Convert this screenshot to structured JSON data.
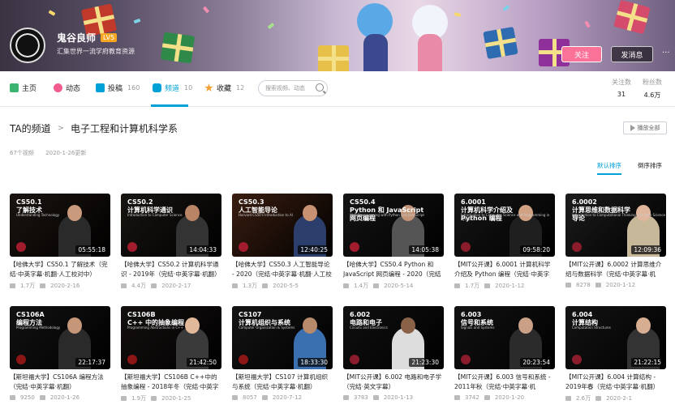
{
  "user": {
    "name": "鬼谷良师",
    "level": "LV5",
    "signature": "汇集世界一流学府教育资源",
    "follow_label": "关注",
    "message_label": "发消息",
    "more": "···"
  },
  "nav": {
    "items": [
      {
        "label": "主页",
        "count": ""
      },
      {
        "label": "动态",
        "count": ""
      },
      {
        "label": "投稿",
        "count": "160"
      },
      {
        "label": "频道",
        "count": "10"
      },
      {
        "label": "收藏",
        "count": "12"
      }
    ],
    "search_placeholder": "搜索视频、动态",
    "stats": [
      {
        "label": "关注数",
        "value": "31"
      },
      {
        "label": "粉丝数",
        "value": "4.6万"
      }
    ]
  },
  "channel": {
    "crumb_root": "TA的频道",
    "crumb_sep": ">",
    "name": "电子工程和计算机科学系",
    "play_all": "播放全部",
    "video_count": "67个视频",
    "updated": "2020-1-26更新",
    "sort_default": "默认排序",
    "sort_reverse": "倒序排序"
  },
  "colors": {
    "accent": "#00a1d6",
    "follow": "#fb7299"
  },
  "videos": [
    {
      "thumb_title": "CS50.1\n了解技术",
      "thumb_sub": "Understanding Technology",
      "duration": "05:55:18",
      "title": "【哈佛大学】CS50.1 了解技术（完结·中英字幕·机翻·人工校对中）",
      "views": "1.7万",
      "date": "2020-2-16",
      "bg": "#1b1410",
      "skin": "#c99a7c",
      "shirt": "#2a2a2a",
      "logo": "#a11c2c"
    },
    {
      "thumb_title": "CS50.2\n计算机科学通识",
      "thumb_sub": "Introduction to Computer Science",
      "duration": "14:04:33",
      "title": "【哈佛大学】CS50.2 计算机科学通识 - 2019年（完结·中英字幕·机翻）",
      "views": "4.4万",
      "date": "2020-2-17",
      "bg": "#181512",
      "skin": "#b98466",
      "shirt": "#333",
      "logo": "#a11c2c"
    },
    {
      "thumb_title": "CS50.3\n人工智能导论",
      "thumb_sub": "Harvard CS50's Introduction to AI",
      "duration": "12:40:25",
      "title": "【哈佛大学】CS50.3 人工智能导论 - 2020（完结·中英字幕·机翻·人工校",
      "views": "1.3万",
      "date": "2020-5-5",
      "bg": "#3a1d10",
      "skin": "#c89272",
      "shirt": "#2c3e6b",
      "logo": "#a11c2c"
    },
    {
      "thumb_title": "CS50.4\nPython 和 JavaScript\n网页编程",
      "thumb_sub": "Web Programming with Python and JavaScript",
      "duration": "14:05:38",
      "title": "【哈佛大学】CS50.4 Python 和 JavaScript 网页编程 - 2020（完结",
      "views": "1.4万",
      "date": "2020-5-14",
      "bg": "#141414",
      "skin": "#c29477",
      "shirt": "#555",
      "logo": "#a11c2c"
    },
    {
      "thumb_title": "6.0001\n计算机科学介绍及\nPython 编程",
      "thumb_sub": "Introduction to Computer Science and Programming in Python",
      "duration": "09:58:20",
      "title": "【MIT公开课】6.0001 计算机科学介绍及 Python 编程（完结·中英字",
      "views": "1.7万",
      "date": "2020-1-12",
      "bg": "#161616",
      "skin": "#d1a184",
      "shirt": "#1f1f1f",
      "logo": "#8a1c2c"
    },
    {
      "thumb_title": "6.0002\n计算思维和数据科学\n导论",
      "thumb_sub": "Introduction to Computational Thinking and Data Science",
      "duration": "12:09:36",
      "title": "【MIT公开课】6.0002 计算思维介绍与数据科学（完结·中英字幕·机",
      "views": "8278",
      "date": "2020-1-12",
      "bg": "#1c1c1c",
      "skin": "#e0b69c",
      "shirt": "#c8b89a",
      "logo": "#8a1c2c"
    },
    {
      "thumb_title": "CS106A\n编程方法",
      "thumb_sub": "Programming Methodology",
      "duration": "22:17:37",
      "title": "【斯坦福大学】CS106A 编程方法（完结·中英字幕·机翻）",
      "views": "9250",
      "date": "2020-1-26",
      "bg": "#121212",
      "skin": "#c69679",
      "shirt": "#2a2a2a",
      "logo": "#8c1515"
    },
    {
      "thumb_title": "CS106B\nC++ 中的抽象编程",
      "thumb_sub": "Programming Abstractions in C++",
      "duration": "21:42:50",
      "title": "【斯坦福大学】CS106B C++中的抽象编程 - 2018年冬（完结·中英字",
      "views": "1.9万",
      "date": "2020-1-25",
      "bg": "#151010",
      "skin": "#e2b89a",
      "shirt": "#3a3a3a",
      "logo": "#8c1515"
    },
    {
      "thumb_title": "CS107\n计算机组织与系统",
      "thumb_sub": "Computer Organization & Systems",
      "duration": "18:33:30",
      "title": "【斯坦福大学】CS107 计算机组织与系统（完结·中英字幕·机翻）",
      "views": "8057",
      "date": "2020-7-12",
      "bg": "#141414",
      "skin": "#b88a6c",
      "shirt": "#3a6fb0",
      "logo": "#8c1515"
    },
    {
      "thumb_title": "6.002\n电路和电子",
      "thumb_sub": "Circuits and Electronics",
      "duration": "21:23:30",
      "title": "【MIT公开课】6.002 电路和电子学（完结·英文字幕）",
      "views": "3783",
      "date": "2020-1-13",
      "bg": "#101010",
      "skin": "#8a6248",
      "shirt": "#ddd",
      "logo": "#8a1c2c"
    },
    {
      "thumb_title": "6.003\n信号和系统",
      "thumb_sub": "Signals and Systems",
      "duration": "20:23:54",
      "title": "【MIT公开课】6.003 信号和系统 - 2011年秋（完结·中英字幕·机",
      "views": "3742",
      "date": "2020-1-20",
      "bg": "#121212",
      "skin": "#caa086",
      "shirt": "#2b2b2b",
      "logo": "#8a1c2c"
    },
    {
      "thumb_title": "6.004\n计算结构",
      "thumb_sub": "Computation Structures",
      "duration": "21:22:15",
      "title": "【MIT公开课】6.004 计算结构 - 2019年春（完结·中英字幕·机翻）",
      "views": "2.6万",
      "date": "2020-2-1",
      "bg": "#141414",
      "skin": "#d8ae92",
      "shirt": "#333",
      "logo": "#8a1c2c"
    }
  ]
}
